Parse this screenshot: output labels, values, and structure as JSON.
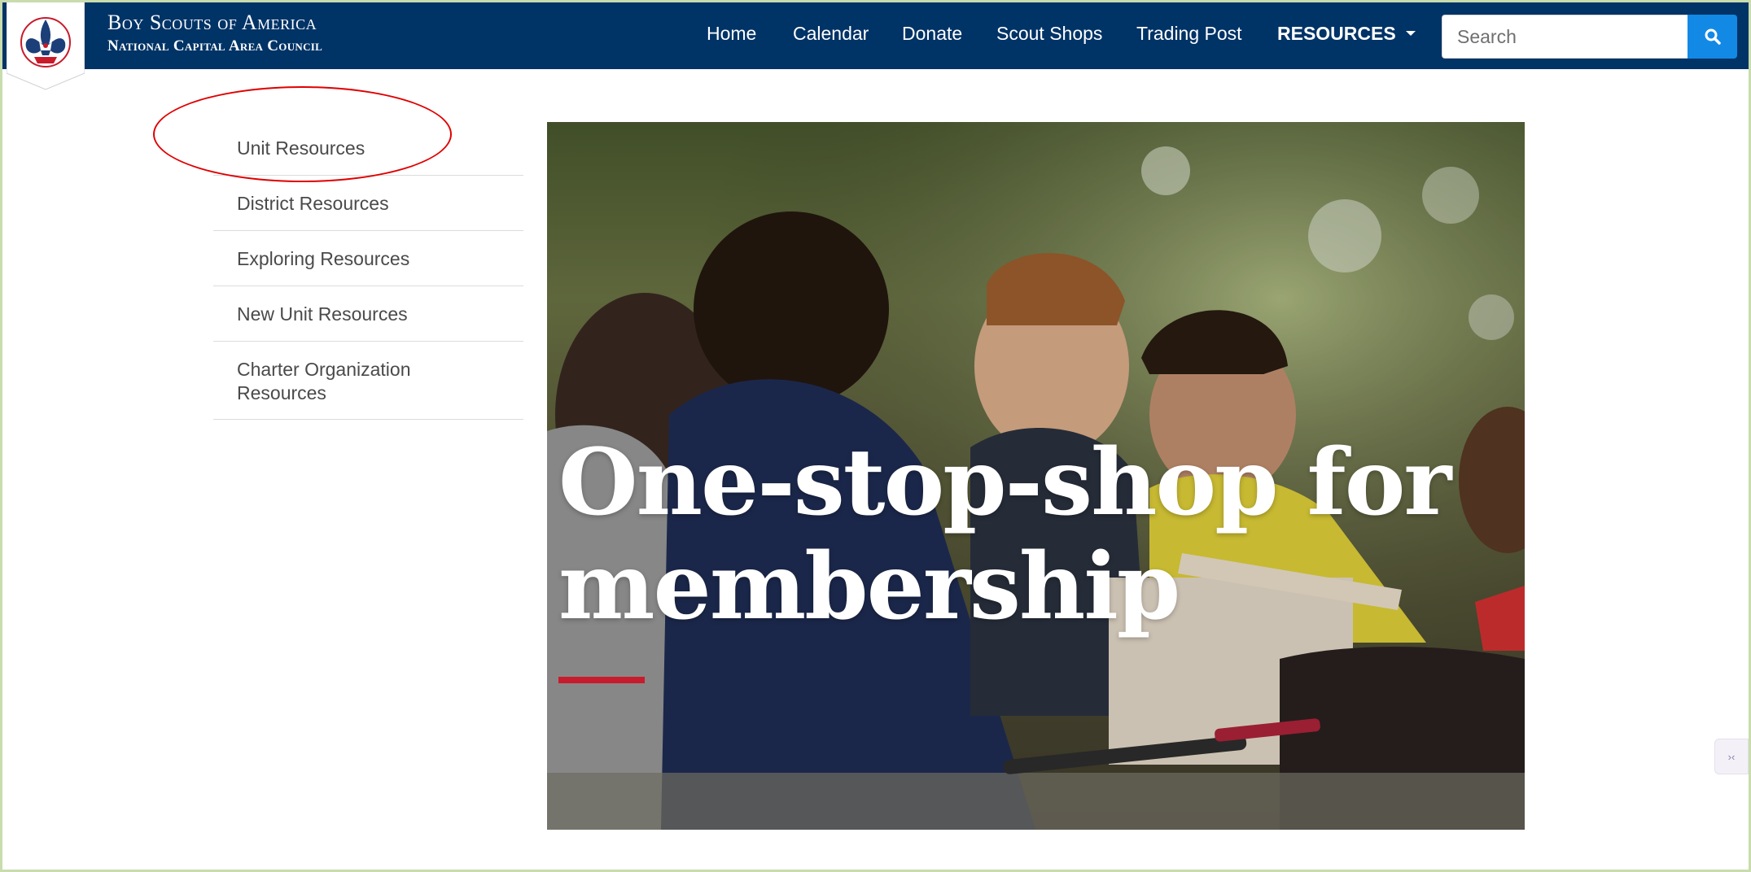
{
  "header": {
    "brand_line1": "Boy Scouts of America",
    "brand_line2": "National Capital Area Council",
    "nav": [
      {
        "label": "Home"
      },
      {
        "label": "Calendar"
      },
      {
        "label": "Donate"
      },
      {
        "label": "Scout Shops"
      },
      {
        "label": "Trading Post"
      },
      {
        "label": "RESOURCES"
      }
    ],
    "search_placeholder": "Search",
    "search_icon": "search-icon"
  },
  "sidebar": {
    "items": [
      {
        "label": "Unit Resources"
      },
      {
        "label": "District Resources"
      },
      {
        "label": "Exploring Resources"
      },
      {
        "label": "New Unit Resources"
      },
      {
        "label": "Charter Organization Resources"
      }
    ]
  },
  "hero": {
    "title": "One-stop-shop for membership"
  },
  "colors": {
    "navbar": "#003366",
    "search_button": "#1389e6",
    "accent_rule": "#c81b2c",
    "annotation": "#e00000"
  }
}
